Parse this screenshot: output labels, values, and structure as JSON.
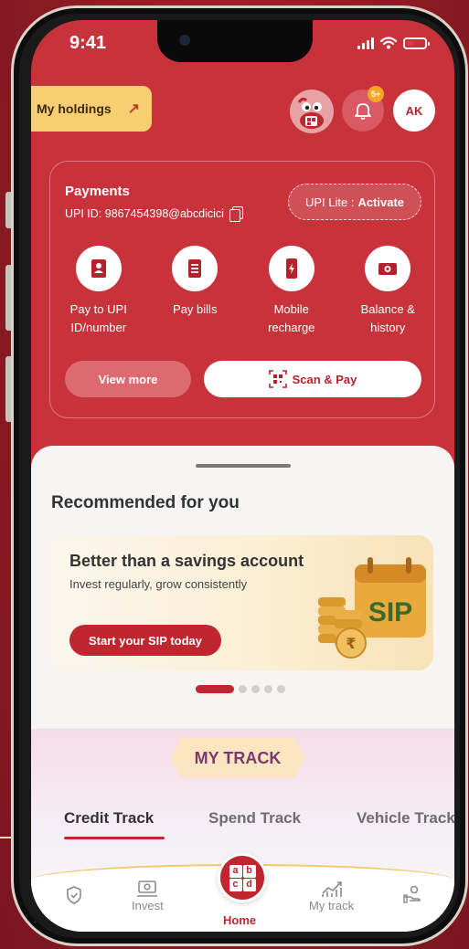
{
  "status_bar": {
    "time": "9:41"
  },
  "header": {
    "holdings_label": "My holdings",
    "notification_badge": "5+",
    "avatar_initials": "AK"
  },
  "payments": {
    "title": "Payments",
    "upi_id": "UPI ID: 9867454398@abcdicici",
    "upi_lite_prefix": "UPI Lite :",
    "upi_lite_action": "Activate",
    "actions": [
      {
        "label": "Pay to UPI ID/number",
        "icon": "contact-book-icon"
      },
      {
        "label": "Pay bills",
        "icon": "bill-icon"
      },
      {
        "label": "Mobile recharge",
        "icon": "mobile-recharge-icon"
      },
      {
        "label": "Balance & history",
        "icon": "balance-icon"
      }
    ],
    "view_more_label": "View more",
    "scan_pay_label": "Scan & Pay"
  },
  "recommended": {
    "title": "Recommended for you",
    "banner": {
      "headline": "Better than a savings account",
      "subtitle": "Invest regularly, grow consistently",
      "cta": "Start your SIP today",
      "art_text": "SIP"
    },
    "carousel_count": 5,
    "carousel_active": 0
  },
  "my_track": {
    "title": "MY TRACK",
    "tabs": [
      "Credit Track",
      "Spend Track",
      "Vehicle Track"
    ],
    "active_tab": 0
  },
  "bottom_nav": {
    "items": [
      {
        "label": "",
        "icon": "shield-icon"
      },
      {
        "label": "Invest",
        "icon": "invest-icon"
      },
      {
        "label": "Home",
        "icon": "home-abcd-icon"
      },
      {
        "label": "My track",
        "icon": "chart-icon"
      },
      {
        "label": "",
        "icon": "hand-money-icon"
      }
    ],
    "home_letters": [
      "a",
      "b",
      "c",
      "d"
    ]
  },
  "colors": {
    "brand_red": "#c8323a",
    "accent_yellow": "#f7cf72",
    "cta_red": "#c0262f"
  }
}
